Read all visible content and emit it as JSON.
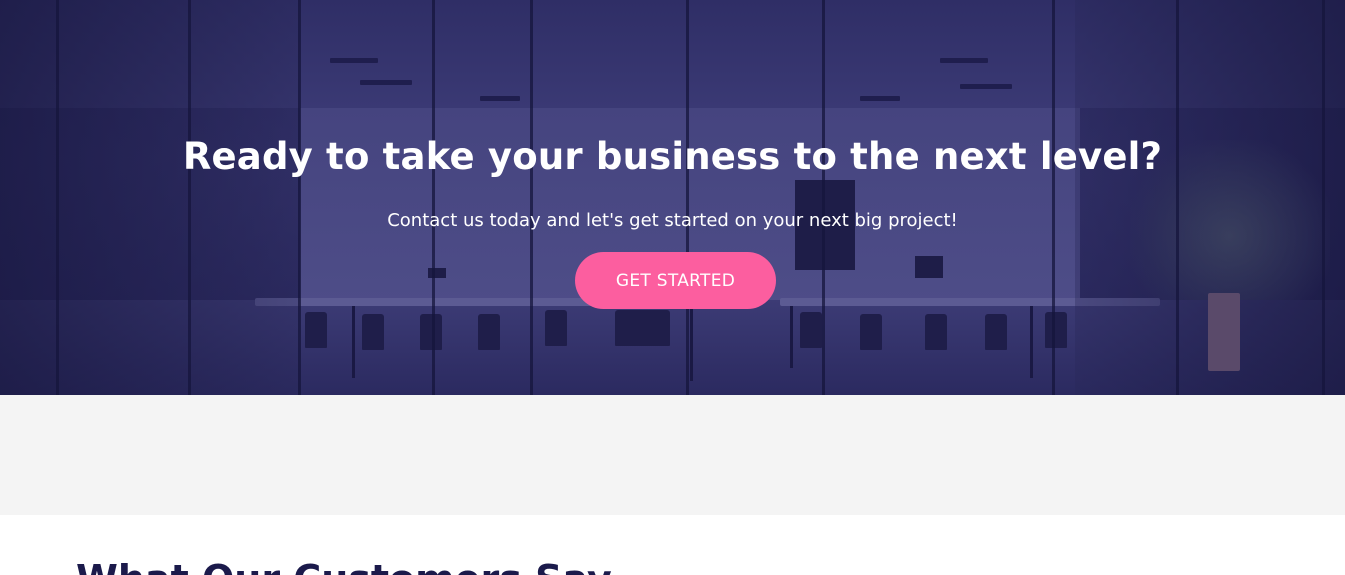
{
  "cta_section": {
    "title": "Ready to take your business to the next level?",
    "subtitle": "Contact us today and let's get started on your next big project!",
    "button_label": "GET STARTED",
    "colors": {
      "overlay": "#2b2a5c",
      "button": "#fc5e9f",
      "text": "#ffffff"
    },
    "background_image": "office-meeting-room-photo"
  },
  "spacer_band": {
    "color": "#f4f4f4"
  },
  "testimonials_section": {
    "heading": "What Our Customers Say",
    "heading_color": "#1b1a4b"
  }
}
